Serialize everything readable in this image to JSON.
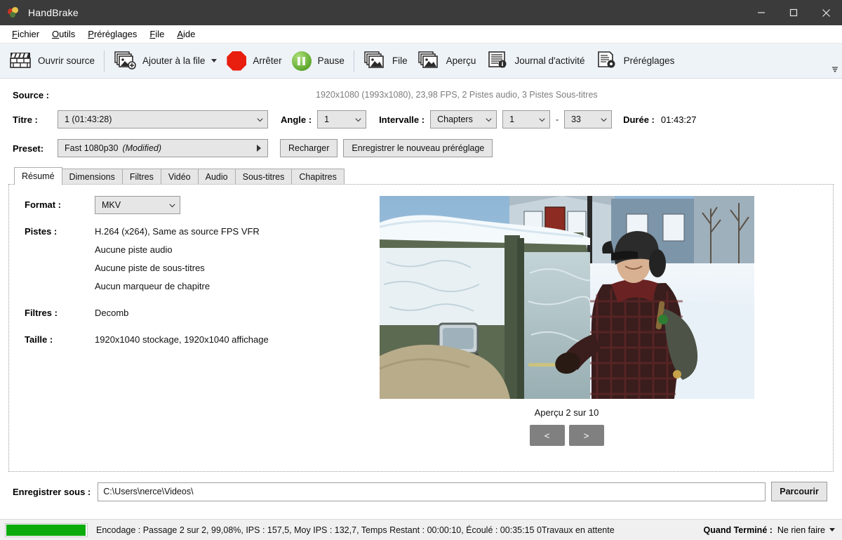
{
  "window": {
    "title": "HandBrake",
    "app_icon": "handbrake-pineapple-icon",
    "minimize_label": "─",
    "maximize_label": "□",
    "close_label": "✕"
  },
  "menubar": {
    "items": [
      {
        "label": "Fichier",
        "accel": "F"
      },
      {
        "label": "Outils",
        "accel": "O"
      },
      {
        "label": "Préréglages",
        "accel": "P"
      },
      {
        "label": "File",
        "accel": "F"
      },
      {
        "label": "Aide",
        "accel": "A"
      }
    ]
  },
  "toolbar": {
    "open_source": "Ouvrir source",
    "add_to_queue": "Ajouter à la file",
    "stop": "Arrêter",
    "pause": "Pause",
    "queue": "File",
    "preview": "Aperçu",
    "activity_log": "Journal d'activité",
    "presets": "Préréglages",
    "overflow": "≡"
  },
  "source": {
    "label": "Source :",
    "info": "1920x1080 (1993x1080), 23,98 FPS, 2 Pistes audio, 3 Pistes Sous-titres",
    "title_label": "Titre :",
    "title_value": "1  (01:43:28)",
    "angle_label": "Angle :",
    "angle_value": "1",
    "range_label": "Intervalle :",
    "range_type": "Chapters",
    "range_start": "1",
    "range_sep": "-",
    "range_end": "33",
    "duration_label": "Durée :",
    "duration_value": "01:43:27"
  },
  "preset": {
    "label": "Preset:",
    "value": "Fast 1080p30",
    "value_suffix": "(Modified)",
    "reload_label": "Recharger",
    "save_new_label": "Enregistrer le nouveau préréglage"
  },
  "tabs": [
    {
      "label": "Résumé",
      "active": true
    },
    {
      "label": "Dimensions",
      "active": false
    },
    {
      "label": "Filtres",
      "active": false
    },
    {
      "label": "Vidéo",
      "active": false
    },
    {
      "label": "Audio",
      "active": false
    },
    {
      "label": "Sous-titres",
      "active": false
    },
    {
      "label": "Chapitres",
      "active": false
    }
  ],
  "summary": {
    "format_label": "Format :",
    "format_value": "MKV",
    "tracks_label": "Pistes :",
    "tracks": [
      "H.264 (x264), Same as source FPS VFR",
      "Aucune piste audio",
      "Aucune piste de sous-titres",
      "Aucun marqueur de chapitre"
    ],
    "filters_label": "Filtres :",
    "filters_value": "Decomb",
    "size_label": "Taille :",
    "size_value": "1920x1040 stockage, 1920x1040 affichage"
  },
  "preview": {
    "caption": "Aperçu 2 sur 10",
    "prev_label": "<",
    "next_label": ">"
  },
  "destination": {
    "label": "Enregistrer sous :",
    "value": "C:\\Users\\nerce\\Videos\\",
    "placeholder": "C:\\Users\\nerce\\Videos\\",
    "browse_label": "Parcourir"
  },
  "status": {
    "progress_percent": 99.08,
    "text": "Encodage : Passage 2 sur 2,  99,08%, IPS :  157,5, Moy IPS :  132,7,  Temps Restant : 00:00:10, Écoulé : 00:35:15 0Travaux en attente",
    "when_done_label": "Quand Terminé :",
    "when_done_value": "Ne rien faire"
  },
  "colors": {
    "titlebar": "#3b3b3b",
    "toolbar": "#eef3f8",
    "progress_green": "#0bab0b",
    "stop_red": "#e81e0f",
    "pause_green": "#5fa830"
  }
}
